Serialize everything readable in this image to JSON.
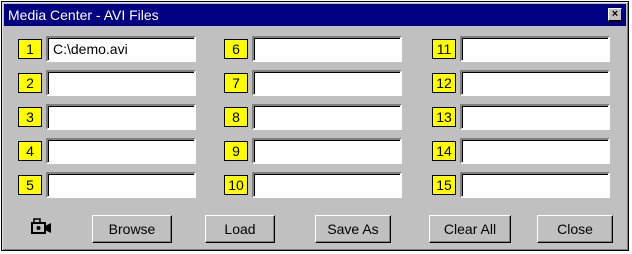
{
  "window": {
    "title": "Media Center - AVI Files",
    "close_glyph": "×"
  },
  "slots": [
    {
      "number": "1",
      "value": "C:\\demo.avi"
    },
    {
      "number": "2",
      "value": ""
    },
    {
      "number": "3",
      "value": ""
    },
    {
      "number": "4",
      "value": ""
    },
    {
      "number": "5",
      "value": ""
    },
    {
      "number": "6",
      "value": ""
    },
    {
      "number": "7",
      "value": ""
    },
    {
      "number": "8",
      "value": ""
    },
    {
      "number": "9",
      "value": ""
    },
    {
      "number": "10",
      "value": ""
    },
    {
      "number": "11",
      "value": ""
    },
    {
      "number": "12",
      "value": ""
    },
    {
      "number": "13",
      "value": ""
    },
    {
      "number": "14",
      "value": ""
    },
    {
      "number": "15",
      "value": ""
    }
  ],
  "buttons": {
    "browse": "Browse",
    "load": "Load",
    "save_as": "Save As",
    "clear_all": "Clear All",
    "close": "Close"
  },
  "icons": {
    "camera": "video-camera-icon"
  },
  "colors": {
    "titlebar": "#000080",
    "number_badge": "#ffff00",
    "face": "#c0c0c0"
  }
}
